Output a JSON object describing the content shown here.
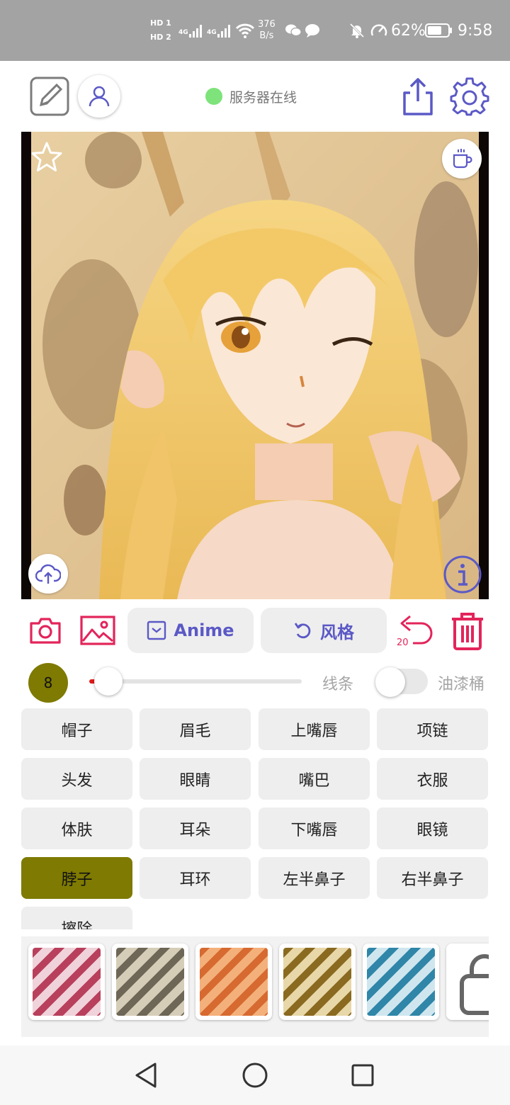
{
  "status_bar": {
    "sim1": "HD 1",
    "sim2": "HD 2",
    "net1": "4G",
    "net2": "4G",
    "speed_value": "376",
    "speed_unit": "B/s",
    "battery": "62%",
    "time": "9:58"
  },
  "header": {
    "server_status": "服务器在线",
    "server_status_color": "#7de37a"
  },
  "toolbar": {
    "mode_button": "Anime",
    "style_button": "风格",
    "undo_count": "20"
  },
  "brush": {
    "size": "8",
    "size_fraction": 0.09,
    "line_label": "线条",
    "bucket_label": "油漆桶",
    "bucket_enabled": false
  },
  "parts": [
    {
      "label": "帽子",
      "selected": false
    },
    {
      "label": "眉毛",
      "selected": false
    },
    {
      "label": "上嘴唇",
      "selected": false
    },
    {
      "label": "项链",
      "selected": false
    },
    {
      "label": "头发",
      "selected": false
    },
    {
      "label": "眼睛",
      "selected": false
    },
    {
      "label": "嘴巴",
      "selected": false
    },
    {
      "label": "衣服",
      "selected": false
    },
    {
      "label": "体肤",
      "selected": false
    },
    {
      "label": "耳朵",
      "selected": false
    },
    {
      "label": "下嘴唇",
      "selected": false
    },
    {
      "label": "眼镜",
      "selected": false
    },
    {
      "label": "脖子",
      "selected": true
    },
    {
      "label": "耳环",
      "selected": false
    },
    {
      "label": "左半鼻子",
      "selected": false
    },
    {
      "label": "右半鼻子",
      "selected": false
    },
    {
      "label": "擦除",
      "selected": false
    }
  ],
  "style_swatches": [
    {
      "name": "crimson-style",
      "colors": [
        "#b8405c",
        "#f0d2da"
      ]
    },
    {
      "name": "grey-style",
      "colors": [
        "#6e6656",
        "#d6cdb8"
      ]
    },
    {
      "name": "orange-style",
      "colors": [
        "#d66a30",
        "#f3b07a"
      ]
    },
    {
      "name": "ochre-style",
      "colors": [
        "#8a6a20",
        "#e8d7a8"
      ]
    },
    {
      "name": "blue-style",
      "colors": [
        "#2f86a8",
        "#cfe6ef"
      ]
    }
  ],
  "colors": {
    "accent_purple": "#5b59c6",
    "accent_red": "#e3245a",
    "selected_olive": "#7e7a02"
  }
}
